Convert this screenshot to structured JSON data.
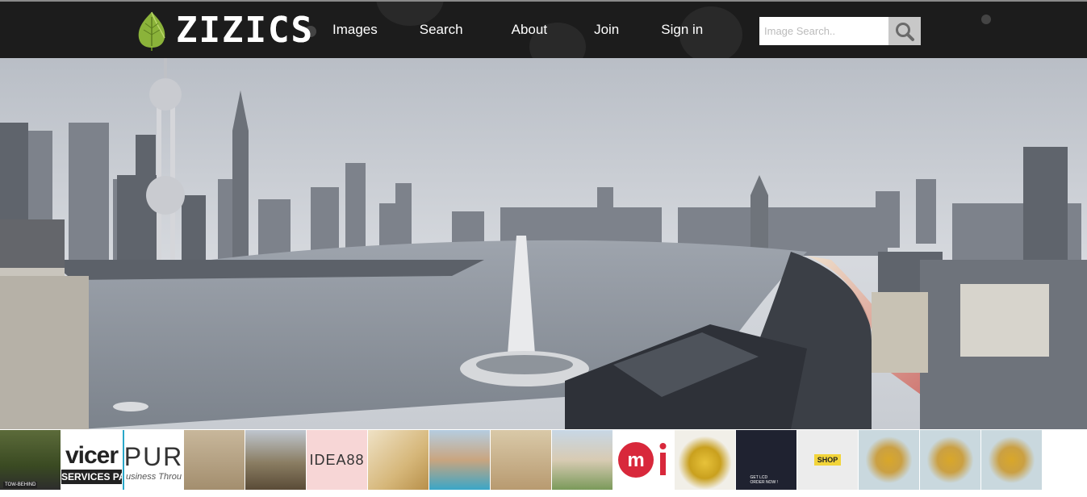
{
  "brand": {
    "logo_text": "ZIZICS",
    "logo_icon": "leaf-icon"
  },
  "nav": {
    "links": [
      {
        "label": "Images"
      },
      {
        "label": "Search"
      },
      {
        "label": "About"
      },
      {
        "label": "Join"
      },
      {
        "label": "Sign in"
      }
    ]
  },
  "search": {
    "placeholder": "Image Search..",
    "value": "",
    "icon": "magnifier-icon"
  },
  "hero": {
    "subject": "city skyline riverside panorama"
  },
  "thumbnails": [
    {
      "caption": "TOW-BEHIND"
    },
    {
      "caption": "vicer",
      "subcaption": "SERVICES PA"
    },
    {
      "caption": "PUR",
      "subcaption": "usiness Throu"
    },
    {
      "caption": ""
    },
    {
      "caption": ""
    },
    {
      "caption": "IDEA88"
    },
    {
      "caption": ""
    },
    {
      "caption": ""
    },
    {
      "caption": ""
    },
    {
      "caption": ""
    },
    {
      "caption": ""
    },
    {
      "caption": ""
    },
    {
      "caption": "GET LCD ORDER NOW !"
    },
    {
      "caption": "SHOP"
    },
    {
      "caption": ""
    },
    {
      "caption": ""
    },
    {
      "caption": ""
    }
  ],
  "colors": {
    "navbar": "#1c1c1c",
    "search_button": "#c8c8c8",
    "accent_leaf": "#8bb33a"
  }
}
